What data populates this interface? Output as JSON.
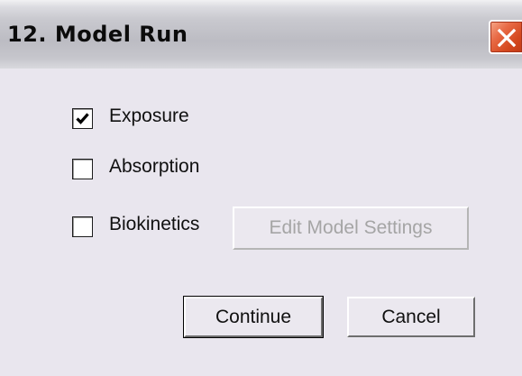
{
  "window": {
    "title": "12. Model Run",
    "close_icon": "close-x-icon"
  },
  "options": [
    {
      "label": "Exposure",
      "checked": true
    },
    {
      "label": "Absorption",
      "checked": false
    },
    {
      "label": "Biokinetics",
      "checked": false
    }
  ],
  "buttons": {
    "edit_model_settings": {
      "label": "Edit Model Settings",
      "enabled": false
    },
    "continue": {
      "label": "Continue",
      "is_default": true
    },
    "cancel": {
      "label": "Cancel"
    }
  },
  "colors": {
    "dialog_background": "#e9e6ee",
    "close_button": "#d4481f",
    "disabled_text": "#a5a5a5"
  }
}
